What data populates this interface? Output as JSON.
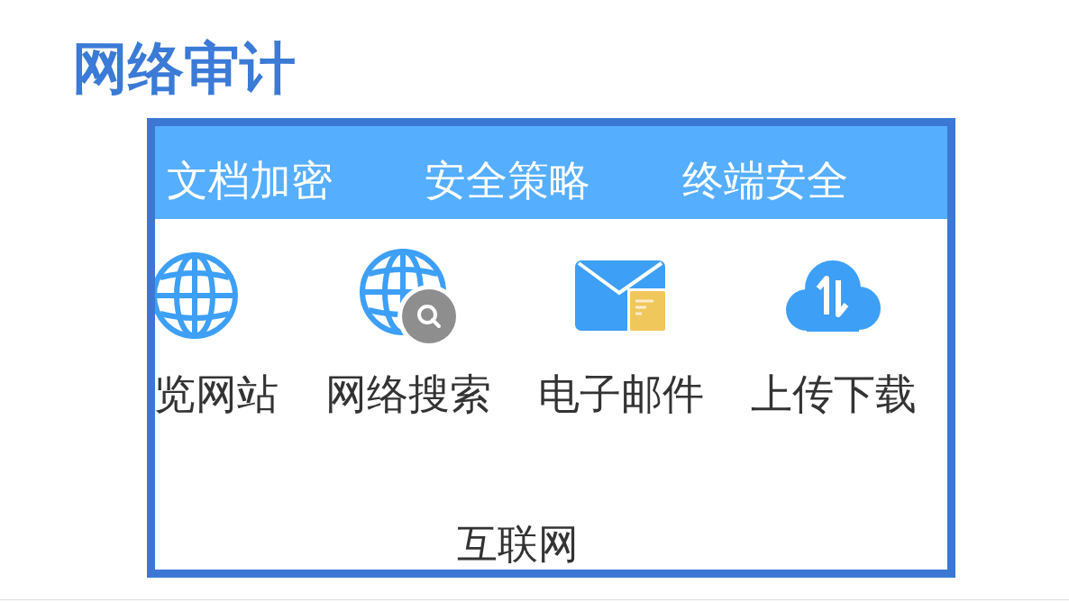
{
  "title": "网络审计",
  "panel": {
    "tabs": [
      {
        "label": "文档加密"
      },
      {
        "label": "安全策略"
      },
      {
        "label": "终端安全"
      }
    ],
    "features": [
      {
        "kind": "website",
        "label": "览网站"
      },
      {
        "kind": "search",
        "label": "网络搜索"
      },
      {
        "kind": "email",
        "label": "电子邮件"
      },
      {
        "kind": "transfer",
        "label": "上传下载"
      }
    ],
    "category": "互联网"
  }
}
